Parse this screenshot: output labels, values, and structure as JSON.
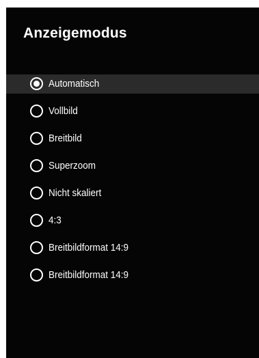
{
  "dialog": {
    "title": "Anzeigemodus",
    "options": [
      {
        "label": "Automatisch",
        "selected": true
      },
      {
        "label": "Vollbild",
        "selected": false
      },
      {
        "label": "Breitbild",
        "selected": false
      },
      {
        "label": "Superzoom",
        "selected": false
      },
      {
        "label": "Nicht skaliert",
        "selected": false
      },
      {
        "label": "4:3",
        "selected": false
      },
      {
        "label": "Breitbildformat 14:9",
        "selected": false
      },
      {
        "label": "Breitbildformat 14:9",
        "selected": false
      }
    ]
  },
  "colors": {
    "panel_background": "#050505",
    "highlight_background": "#2b2b2b",
    "text": "#ffffff"
  }
}
